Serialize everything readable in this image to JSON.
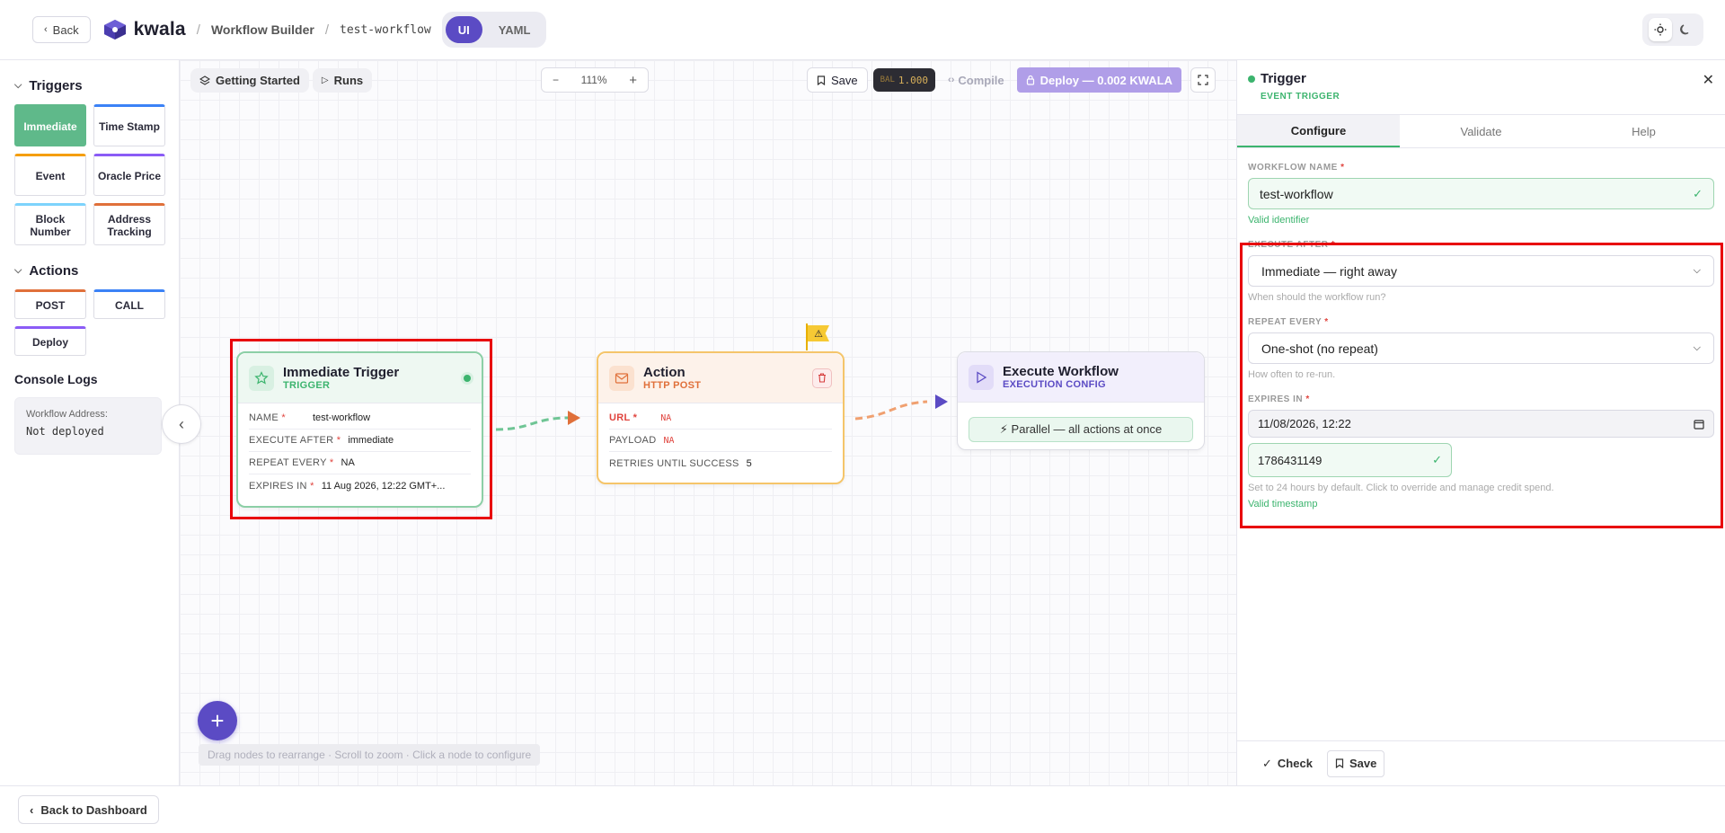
{
  "header": {
    "back_label": "Back",
    "brand": "kwala",
    "crumb_builder": "Workflow Builder",
    "crumb_workflow": "test-workflow",
    "mode_ui": "UI",
    "mode_yaml": "YAML",
    "theme_icons": [
      "sun-icon",
      "moon-icon"
    ]
  },
  "sidebar": {
    "triggers_title": "Triggers",
    "triggers": [
      {
        "label": "Immediate",
        "accent": "#5fb98a",
        "active": true
      },
      {
        "label": "Time Stamp",
        "accent": "#3b82f6"
      },
      {
        "label": "Event",
        "accent": "#f59e0b"
      },
      {
        "label": "Oracle Price",
        "accent": "#8b5cf6"
      },
      {
        "label": "Block Number",
        "accent": "#7dd3fc"
      },
      {
        "label": "Address Tracking",
        "accent": "#e0703a"
      }
    ],
    "actions_title": "Actions",
    "actions": [
      {
        "label": "POST",
        "accent": "#e0703a"
      },
      {
        "label": "CALL",
        "accent": "#3b82f6"
      },
      {
        "label": "Deploy",
        "accent": "#8b5cf6"
      }
    ],
    "console_title": "Console Logs",
    "console_label": "Workflow Address:",
    "console_value": "Not deployed"
  },
  "toolbar": {
    "getting_started": "Getting Started",
    "runs": "Runs",
    "zoom_out": "−",
    "zoom_level": "111%",
    "zoom_in": "+",
    "save": "Save",
    "bal_label": "BAL",
    "bal_value": "1.000",
    "compile": "Compile",
    "deploy": "Deploy — 0.002 KWALA"
  },
  "nodes": {
    "trigger": {
      "title": "Immediate Trigger",
      "subtitle": "TRIGGER",
      "rows": [
        {
          "key": "NAME",
          "required": true,
          "value": "test-workflow"
        },
        {
          "key": "EXECUTE AFTER",
          "required": true,
          "value": "immediate"
        },
        {
          "key": "REPEAT EVERY",
          "required": true,
          "value": "NA"
        },
        {
          "key": "EXPIRES IN",
          "required": true,
          "value": "11 Aug 2026, 12:22 GMT+..."
        }
      ]
    },
    "action": {
      "title": "Action",
      "subtitle": "HTTP POST",
      "rows": [
        {
          "key": "URL",
          "required": true,
          "value": "NA"
        },
        {
          "key": "PAYLOAD",
          "required": false,
          "value": "NA"
        },
        {
          "key": "RETRIES UNTIL SUCCESS",
          "required": false,
          "value": "5"
        }
      ]
    },
    "execute": {
      "title": "Execute Workflow",
      "subtitle": "EXECUTION CONFIG",
      "badge": "⚡ Parallel — all actions at once"
    },
    "warning_flag": "⚠"
  },
  "canvas": {
    "add_label": "+",
    "hint": "Drag nodes to rearrange · Scroll to zoom · Click a node to configure"
  },
  "panel": {
    "title": "Trigger",
    "subtitle": "EVENT TRIGGER",
    "tabs": [
      "Configure",
      "Validate",
      "Help"
    ],
    "workflow_name_label": "WORKFLOW NAME",
    "workflow_name_value": "test-workflow",
    "workflow_name_ok": "Valid identifier",
    "execute_after_label": "EXECUTE AFTER",
    "execute_after_value": "Immediate — right away",
    "execute_after_hint": "When should the workflow run?",
    "repeat_label": "REPEAT EVERY",
    "repeat_value": "One-shot (no repeat)",
    "repeat_hint": "How often to re-run.",
    "expires_label": "EXPIRES IN",
    "expires_date": "11/08/2026, 12:22",
    "expires_ts": "1786431149",
    "expires_hint": "Set to 24 hours by default. Click to override and manage credit spend.",
    "expires_ok": "Valid timestamp",
    "check_label": "Check",
    "save_label": "Save"
  },
  "footer": {
    "back_dashboard": "Back to Dashboard"
  }
}
